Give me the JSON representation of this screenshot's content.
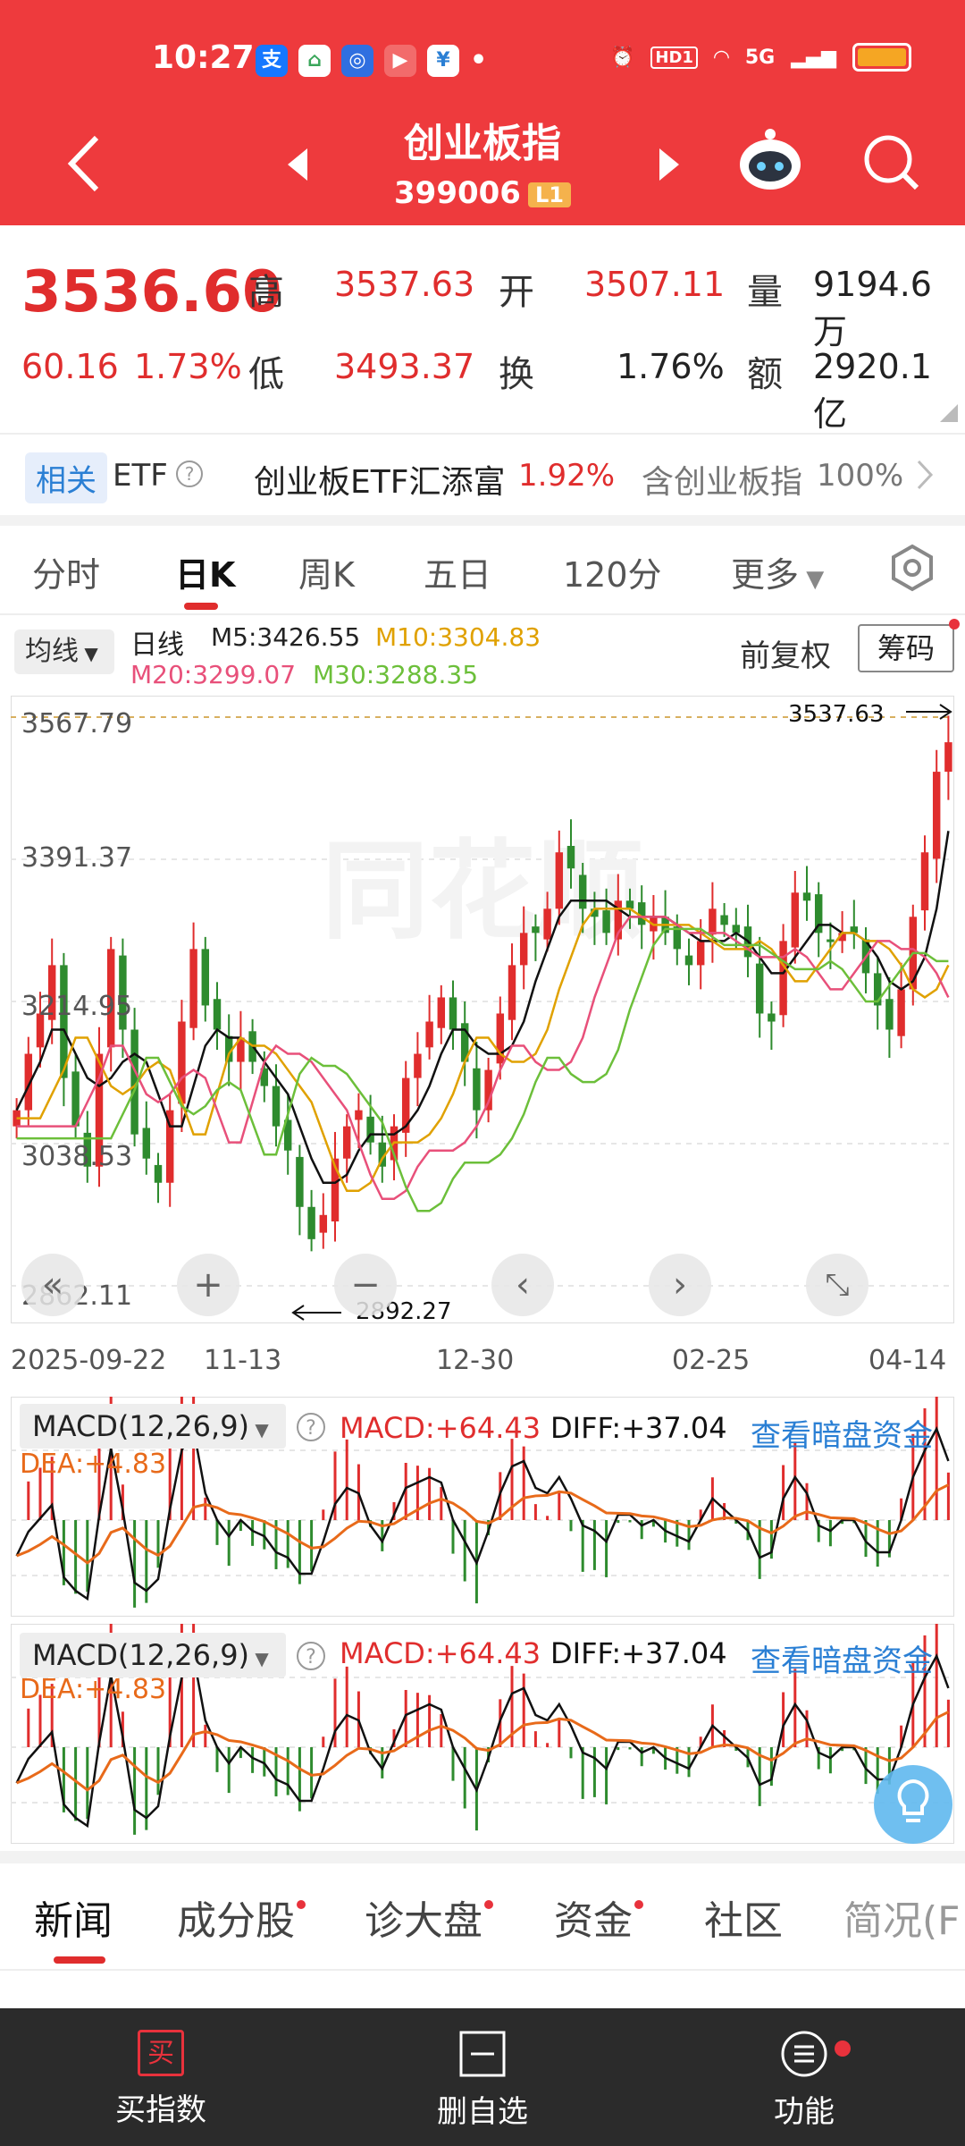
{
  "status": {
    "time": "10:27",
    "hd": "HD1",
    "net": "5G"
  },
  "header": {
    "title": "创业板指",
    "code": "399006",
    "level": "L1"
  },
  "quote": {
    "price": "3536.60",
    "change": "60.16",
    "change_pct": "1.73%",
    "high_label": "高",
    "high": "3537.63",
    "low_label": "低",
    "low": "3493.37",
    "open_label": "开",
    "open": "3507.11",
    "turnover_label": "换",
    "turnover": "1.76%",
    "volume_label": "量",
    "volume": "9194.6万",
    "amount_label": "额",
    "amount": "2920.1亿"
  },
  "etf": {
    "tag": "相关",
    "etf_label": "ETF",
    "name": "创业板ETF汇添富",
    "pct": "1.92%",
    "holding": "含创业板指",
    "holding_pct": "100%"
  },
  "kline_tabs": [
    "分时",
    "日K",
    "周K",
    "五日",
    "120分",
    "更多"
  ],
  "indicator": {
    "selector": "均线",
    "period": "日线",
    "m5": "M5:3426.55",
    "m10": "M10:3304.83",
    "m20": "M20:3299.07",
    "m30": "M30:3288.35",
    "adjust": "前复权",
    "chips": "筹码"
  },
  "chart_data": {
    "type": "candlestick",
    "y_ticks": [
      "3567.79",
      "3391.37",
      "3214.95",
      "3038.53",
      "2862.11"
    ],
    "ylim": [
      2862.11,
      3567.79
    ],
    "x_ticks": [
      "2025-09-22",
      "11-13",
      "12-30",
      "02-25",
      "04-14"
    ],
    "max_label": "3537.63",
    "min_label": "2892.27",
    "close": [
      3080,
      3150,
      3200,
      3260,
      3120,
      3060,
      3010,
      3150,
      3280,
      3180,
      3050,
      3020,
      2990,
      3080,
      3190,
      3280,
      3210,
      3180,
      3140,
      3170,
      3140,
      3110,
      3060,
      3030,
      2960,
      2920,
      2950,
      3020,
      3060,
      3080,
      3040,
      3010,
      3060,
      3120,
      3150,
      3190,
      3220,
      3180,
      3140,
      3080,
      3130,
      3200,
      3260,
      3300,
      3300,
      3330,
      3400,
      3380,
      3330,
      3320,
      3300,
      3340,
      3330,
      3310,
      3320,
      3300,
      3280,
      3260,
      3290,
      3330,
      3310,
      3300,
      3270,
      3200,
      3190,
      3290,
      3350,
      3340,
      3300,
      3290,
      3300,
      3300,
      3250,
      3210,
      3180,
      3230,
      3320,
      3400,
      3500,
      3536.6
    ],
    "ma5": [
      3080,
      3110,
      3140,
      3180,
      3180,
      3150,
      3120,
      3110,
      3120,
      3140,
      3150,
      3140,
      3100,
      3060,
      3060,
      3110,
      3160,
      3180,
      3170,
      3170,
      3160,
      3140,
      3120,
      3100,
      3060,
      3020,
      2990,
      2990,
      3000,
      3030,
      3050,
      3050,
      3050,
      3060,
      3080,
      3110,
      3150,
      3180,
      3180,
      3160,
      3150,
      3150,
      3160,
      3190,
      3240,
      3280,
      3320,
      3340,
      3340,
      3340,
      3340,
      3330,
      3320,
      3320,
      3320,
      3320,
      3310,
      3300,
      3290,
      3290,
      3290,
      3300,
      3290,
      3270,
      3250,
      3250,
      3270,
      3290,
      3310,
      3310,
      3300,
      3300,
      3290,
      3270,
      3240,
      3230,
      3240,
      3270,
      3330,
      3426.55
    ]
  },
  "macd1": {
    "title": "MACD(12,26,9)",
    "macd": "MACD:+64.43",
    "diff": "DIFF:+37.04",
    "dea": "DEA:+4.83",
    "link": "查看暗盘资金"
  },
  "macd2": {
    "title": "MACD(12,26,9)",
    "macd": "MACD:+64.43",
    "diff": "DIFF:+37.04",
    "dea": "DEA:+4.83",
    "link": "查看暗盘资金"
  },
  "bottom_tabs": [
    "新闻",
    "成分股",
    "诊大盘",
    "资金",
    "社区",
    "简况(F"
  ],
  "bottom_bar": {
    "buy": "买指数",
    "buy_icon": "买",
    "remove": "删自选",
    "func": "功能"
  },
  "colors": {
    "header": "#ee3a3d",
    "up": "#e02d2d",
    "down": "#2e8b2e",
    "link": "#2a7fd4",
    "bar": "#2b2b2b"
  }
}
